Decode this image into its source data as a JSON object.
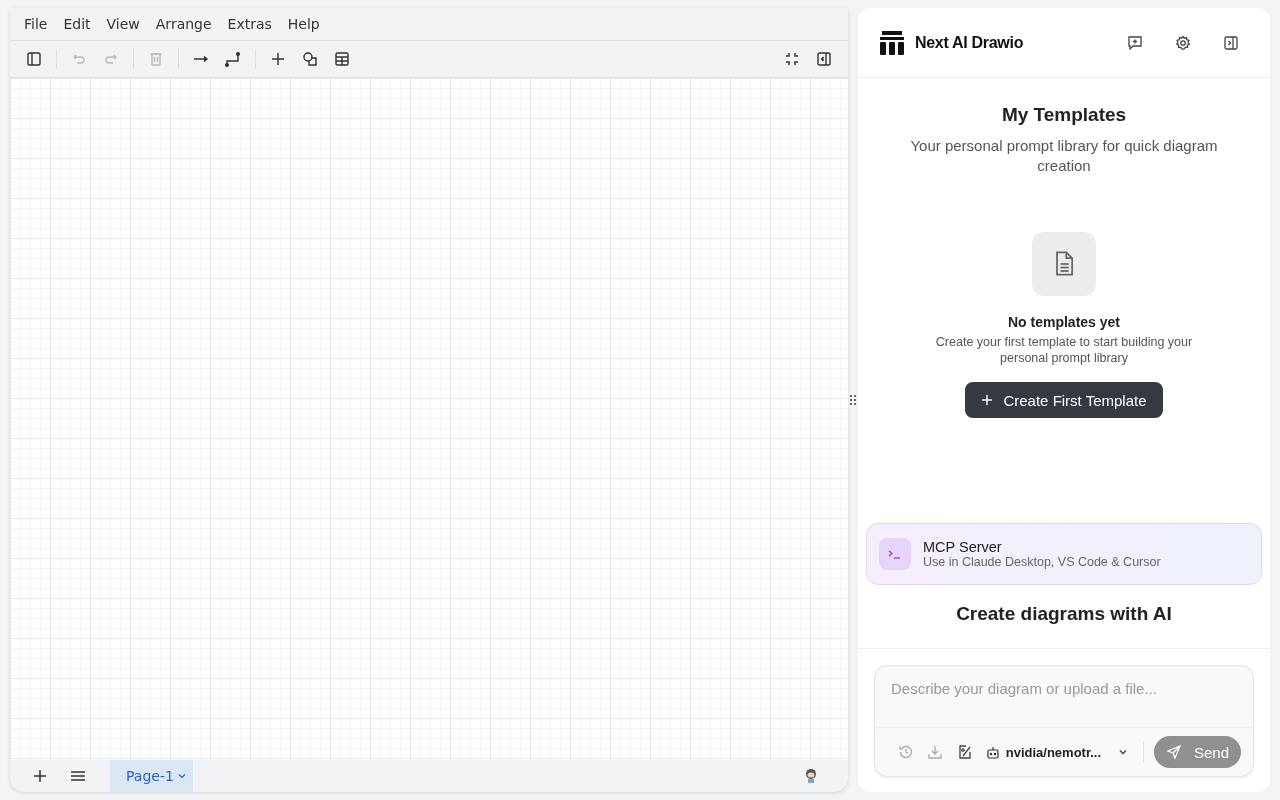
{
  "menu": [
    "File",
    "Edit",
    "View",
    "Arrange",
    "Extras",
    "Help"
  ],
  "toolbar": [
    {
      "kind": "sidebar",
      "disabled": false
    },
    {
      "kind": "sep"
    },
    {
      "kind": "undo",
      "disabled": true
    },
    {
      "kind": "redo",
      "disabled": true
    },
    {
      "kind": "sep"
    },
    {
      "kind": "delete",
      "disabled": true
    },
    {
      "kind": "sep"
    },
    {
      "kind": "edge",
      "disabled": false
    },
    {
      "kind": "waypoint",
      "disabled": false
    },
    {
      "kind": "sep"
    },
    {
      "kind": "plus",
      "disabled": false
    },
    {
      "kind": "shapes",
      "disabled": false
    },
    {
      "kind": "table",
      "disabled": false
    }
  ],
  "pages": [
    {
      "label": "Page-1",
      "selected": true
    }
  ],
  "app": {
    "title": "Next AI Drawio"
  },
  "templates": {
    "heading": "My Templates",
    "subtitle": "Your personal prompt library for quick diagram creation",
    "empty_title": "No templates yet",
    "empty_text": "Create your first template to start building your personal prompt library",
    "button": "Create First Template"
  },
  "mcp": {
    "title": "MCP Server",
    "subtitle": "Use in Claude Desktop, VS Code & Cursor"
  },
  "intro": {
    "heading": "Create diagrams with AI"
  },
  "chat": {
    "placeholder": "Describe your diagram or upload a file...",
    "model": "nvidia/nemotr...",
    "send": "Send",
    "send_disabled": true
  }
}
